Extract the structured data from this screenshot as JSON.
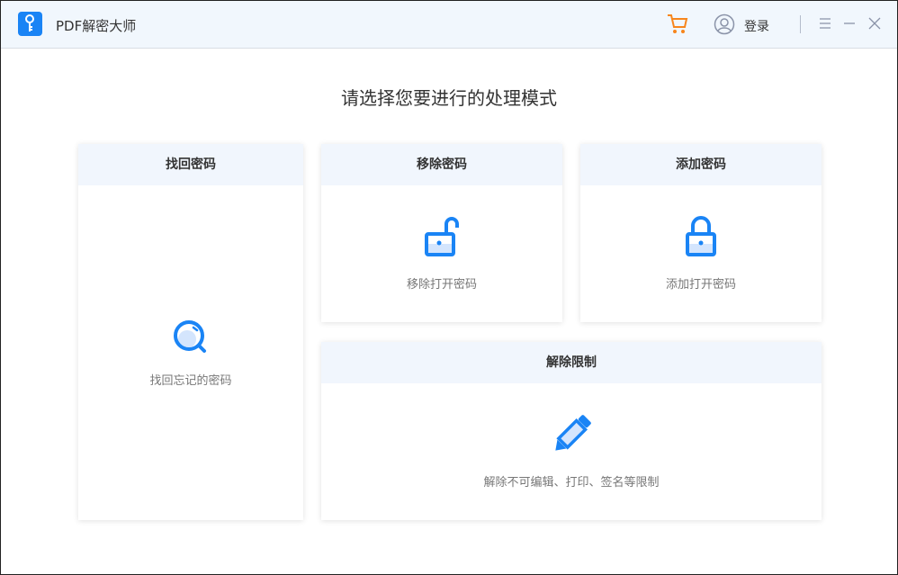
{
  "app": {
    "title": "PDF解密大师",
    "login": "登录"
  },
  "heading": "请选择您要进行的处理模式",
  "cards": [
    {
      "title": "找回密码",
      "desc": "找回忘记的密码"
    },
    {
      "title": "移除密码",
      "desc": "移除打开密码"
    },
    {
      "title": "添加密码",
      "desc": "添加打开密码"
    },
    {
      "title": "解除限制",
      "desc": "解除不可编辑、打印、签名等限制"
    }
  ],
  "colors": {
    "accent": "#1a84f5",
    "cart": "#f7861c"
  }
}
